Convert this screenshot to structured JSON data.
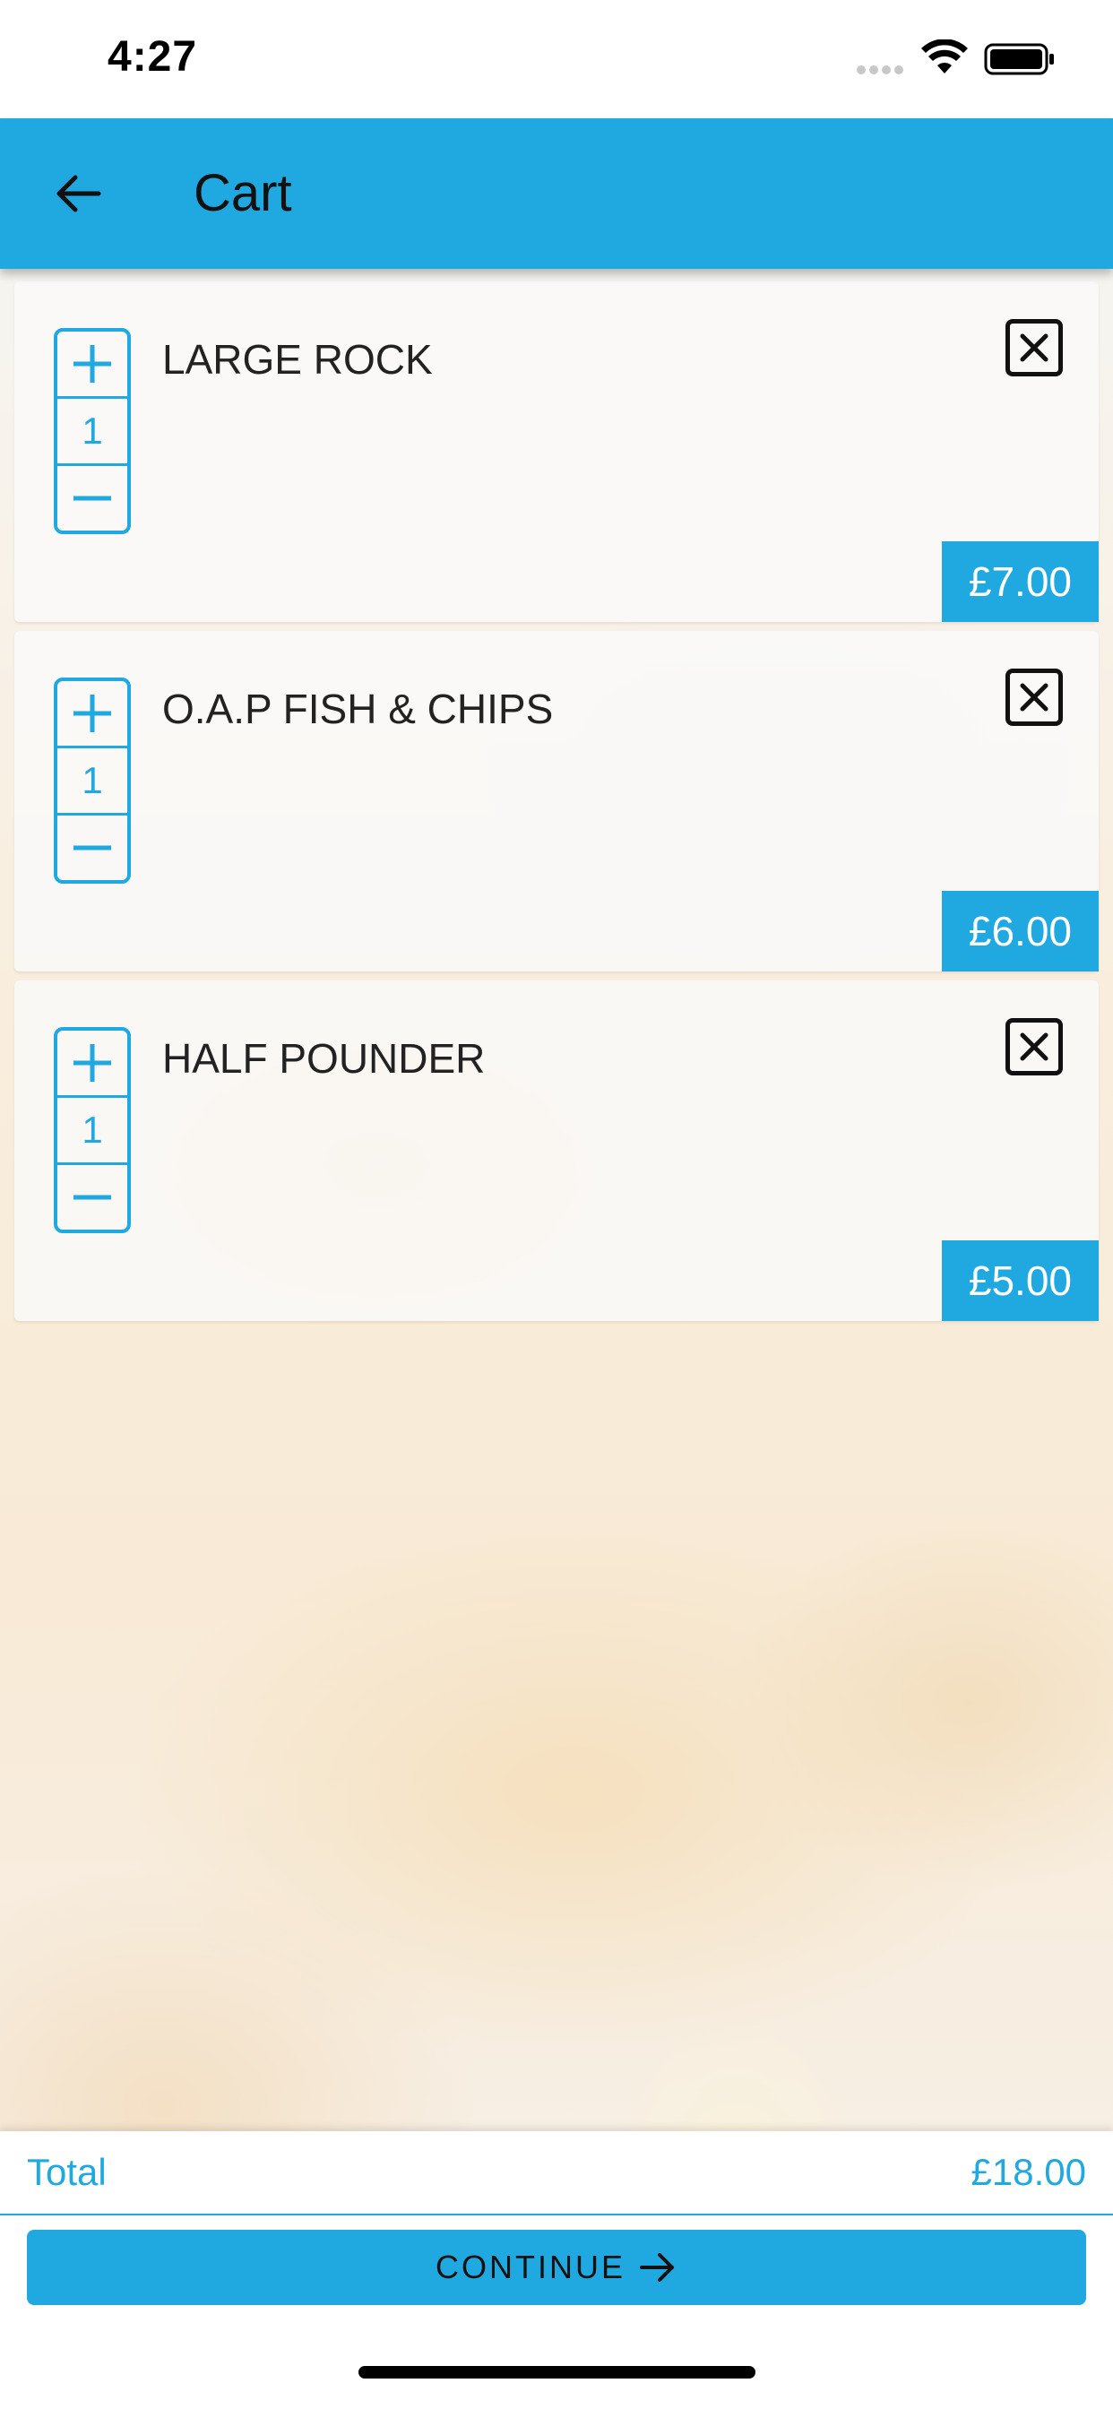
{
  "status_bar": {
    "time": "4:27"
  },
  "header": {
    "title": "Cart",
    "back_icon": "arrow-left-icon",
    "background_color": "#1fa9e0"
  },
  "cart": {
    "items": [
      {
        "name": "LARGE ROCK",
        "quantity": "1",
        "price": "£7.00"
      },
      {
        "name": "O.A.P FISH & CHIPS",
        "quantity": "1",
        "price": "£6.00"
      },
      {
        "name": "HALF POUNDER",
        "quantity": "1",
        "price": "£5.00"
      }
    ],
    "increment_icon": "plus-icon",
    "decrement_icon": "minus-icon",
    "remove_icon": "close-box-icon"
  },
  "footer": {
    "total_label": "Total",
    "total_value": "£18.00",
    "continue_label": "CONTINUE",
    "continue_icon": "arrow-right-icon"
  },
  "colors": {
    "accent": "#1fa9e0",
    "text_dark": "#111111"
  }
}
